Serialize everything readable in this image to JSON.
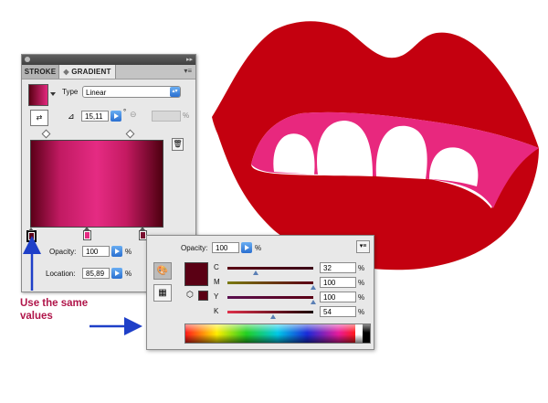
{
  "gradient_panel": {
    "tabs": [
      {
        "label": "STROKE"
      },
      {
        "label": "GRADIENT"
      }
    ],
    "menu_icon": "panel-menu-icon",
    "type_label": "Type",
    "type_value": "Linear",
    "angle_value": "15,11",
    "angle_unit": "°",
    "aspect_unit": "%",
    "opacity_label": "Opacity:",
    "opacity_value": "100",
    "opacity_unit": "%",
    "location_label": "Location:",
    "location_value": "85,89",
    "location_unit": "%",
    "colors": {
      "dark_stop": "#5c0018",
      "pink_stop": "#e52b83"
    }
  },
  "color_panel": {
    "opacity_label": "Opacity:",
    "opacity_value": "100",
    "opacity_unit": "%",
    "fill_color": "#5a0014",
    "channels": [
      {
        "label": "C",
        "value": "32",
        "unit": "%",
        "level": 0.32
      },
      {
        "label": "M",
        "value": "100",
        "unit": "%",
        "level": 1.0
      },
      {
        "label": "Y",
        "value": "100",
        "unit": "%",
        "level": 1.0
      },
      {
        "label": "K",
        "value": "54",
        "unit": "%",
        "level": 0.54
      }
    ]
  },
  "annotation": {
    "line1": "Use the same",
    "line2": "values",
    "color": "#b0154a",
    "arrow_color": "#1e3fc8"
  },
  "illustration": {
    "lip_color": "#c4000f",
    "gum_color": "#e8287e",
    "teeth_color": "#ffffff"
  }
}
